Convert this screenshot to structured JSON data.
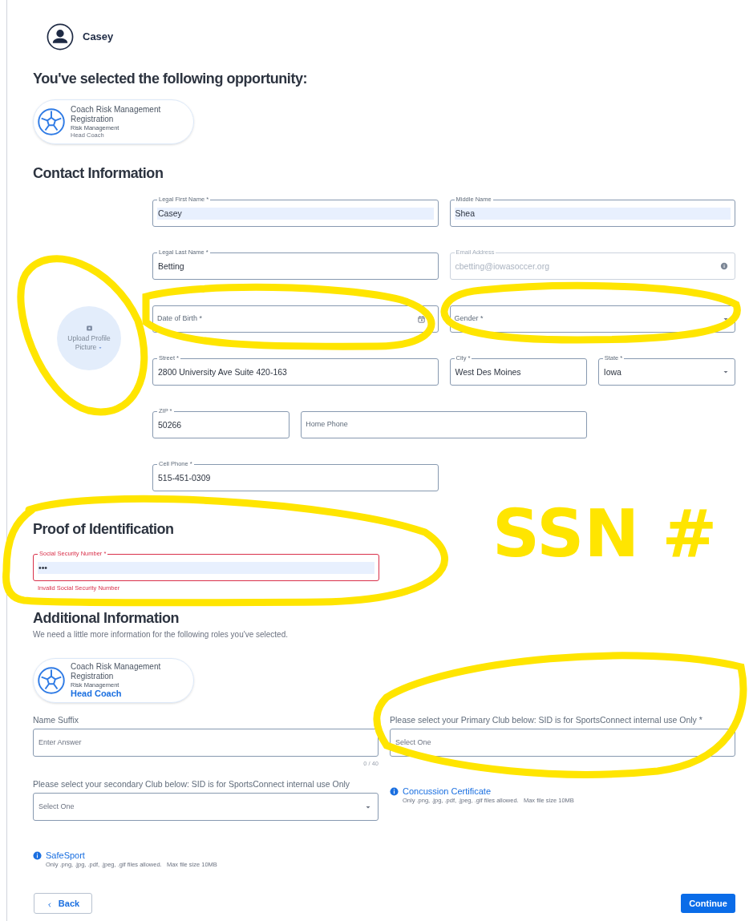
{
  "user": {
    "name": "Casey"
  },
  "opportunity": {
    "heading": "You've selected the following opportunity:",
    "card": {
      "title": "Coach Risk Management Registration",
      "category": "Risk Management",
      "role": "Head Coach",
      "highlight_role": false
    }
  },
  "contact": {
    "heading": "Contact Information",
    "upload": {
      "label": "Upload Profile Picture"
    },
    "rows": [
      [
        {
          "kind": "text",
          "label": "Legal First Name *",
          "value": "Casey",
          "autofilled": true
        },
        {
          "kind": "text",
          "label": "Middle Name",
          "value": "Shea",
          "autofilled": true
        }
      ],
      [
        {
          "kind": "text",
          "label": "Legal Last Name *",
          "value": "Betting",
          "autofilled": false
        },
        {
          "kind": "email",
          "label": "Email Address",
          "value": "cbetting@iowasoccer.org",
          "disabled": true
        }
      ],
      [
        {
          "kind": "date",
          "label": "Date of Birth *"
        },
        {
          "kind": "select",
          "label": "Gender *"
        }
      ],
      [
        {
          "kind": "text",
          "label": "Street *",
          "value": "2800 University Ave Suite 420-163"
        },
        {
          "kind": "text",
          "label": "City *",
          "value": "West Des Moines"
        },
        {
          "kind": "select",
          "label": "State *",
          "value": "Iowa"
        }
      ],
      [
        {
          "kind": "text",
          "label": "ZIP *",
          "value": "50266"
        },
        {
          "kind": "text",
          "label": "Home Phone"
        }
      ],
      [
        {
          "kind": "text",
          "label": "Cell Phone *",
          "value": "515-451-0309"
        }
      ]
    ]
  },
  "proof": {
    "heading": "Proof of Identification",
    "field": {
      "label": "Social Security Number *",
      "value": "•••",
      "autofilled": true,
      "invalid": true,
      "error": "Invalid Social Security Number"
    }
  },
  "additional": {
    "heading": "Additional Information",
    "subtitle": "We need a little more information for the following roles you've selected.",
    "card": {
      "title": "Coach Risk Management Registration",
      "category": "Risk Management",
      "role": "Head Coach",
      "highlight_role": true
    },
    "name_suffix": {
      "label": "Name Suffix",
      "placeholder": "Enter Answer",
      "counter": "0 / 40"
    },
    "secondary_club": {
      "label": "Please select your secondary Club below: SID is for SportsConnect internal use Only",
      "placeholder": "Select One"
    },
    "primary_club": {
      "label": "Please select your Primary Club below: SID is for SportsConnect internal use Only  *",
      "placeholder": "Select One"
    },
    "uploads": [
      {
        "title": "Concussion Certificate",
        "note": "Only .png, .jpg, .pdf, .jpeg, .gif files allowed.   Max file size 10MB"
      },
      {
        "title": "SafeSport",
        "note": "Only .png, .jpg, .pdf, .jpeg, .gif files allowed.   Max file size 10MB"
      }
    ]
  },
  "buttons": {
    "back": "Back",
    "continue": "Continue"
  },
  "annotation": {
    "note": "SSN #"
  }
}
